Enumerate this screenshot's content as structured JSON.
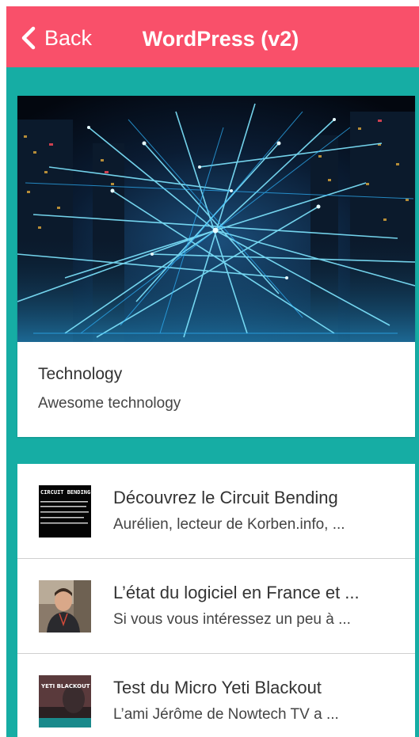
{
  "header": {
    "back_label": "Back",
    "title": "WordPress (v2)",
    "background_color": "#f9506a"
  },
  "content": {
    "background_color": "#16ada4"
  },
  "featured": {
    "title": "Technology",
    "subtitle": "Awesome technology",
    "image": "network-lights-image"
  },
  "posts": [
    {
      "title": "Découvrez le Circuit Bending",
      "excerpt": "Aurélien, lecteur de Korben.info, ...",
      "thumb": "circuit-bending-thumbnail",
      "thumb_caption": "CIRCUIT BENDING"
    },
    {
      "title": "L’état du logiciel en France et ...",
      "excerpt": "Si vous vous intéressez un peu à ...",
      "thumb": "person-portrait-thumbnail"
    },
    {
      "title": "Test du Micro Yeti Blackout",
      "excerpt": "L’ami Jérôme de Nowtech TV a ...",
      "thumb": "yeti-blackout-thumbnail",
      "thumb_caption": "YETI BLACKOUT"
    }
  ]
}
